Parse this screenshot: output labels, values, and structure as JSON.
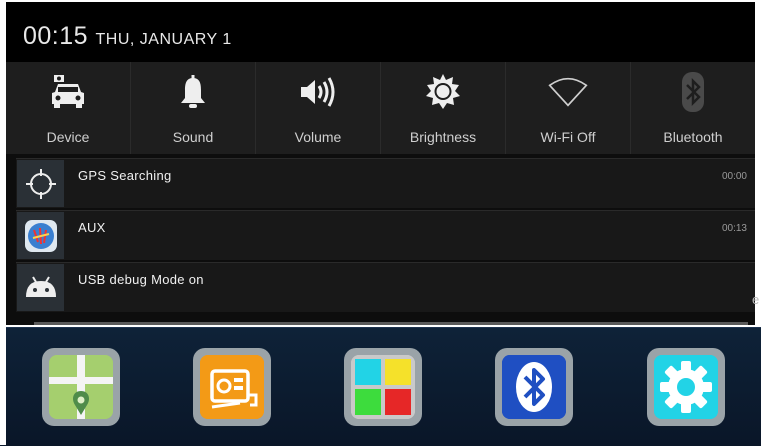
{
  "status": {
    "time": "00:15",
    "date": "THU, JANUARY 1"
  },
  "quick_settings": [
    {
      "label": "Device",
      "icon": "car-icon"
    },
    {
      "label": "Sound",
      "icon": "bell-icon"
    },
    {
      "label": "Volume",
      "icon": "speaker-icon"
    },
    {
      "label": "Brightness",
      "icon": "sun-icon"
    },
    {
      "label": "Wi-Fi Off",
      "icon": "wifi-icon"
    },
    {
      "label": "Bluetooth",
      "icon": "bluetooth-icon"
    }
  ],
  "notifications": [
    {
      "title": "GPS Searching",
      "time": "00:00",
      "icon": "gps-crosshair-icon"
    },
    {
      "title": "AUX",
      "time": "00:13",
      "icon": "aux-app-icon"
    },
    {
      "title": "USB debug Mode on",
      "time": "",
      "icon": "android-icon"
    }
  ],
  "side_text": "e",
  "dock": [
    {
      "icon": "maps-app-icon"
    },
    {
      "icon": "radio-app-icon"
    },
    {
      "icon": "apps-grid-icon"
    },
    {
      "icon": "bluetooth-app-icon"
    },
    {
      "icon": "settings-app-icon"
    }
  ]
}
